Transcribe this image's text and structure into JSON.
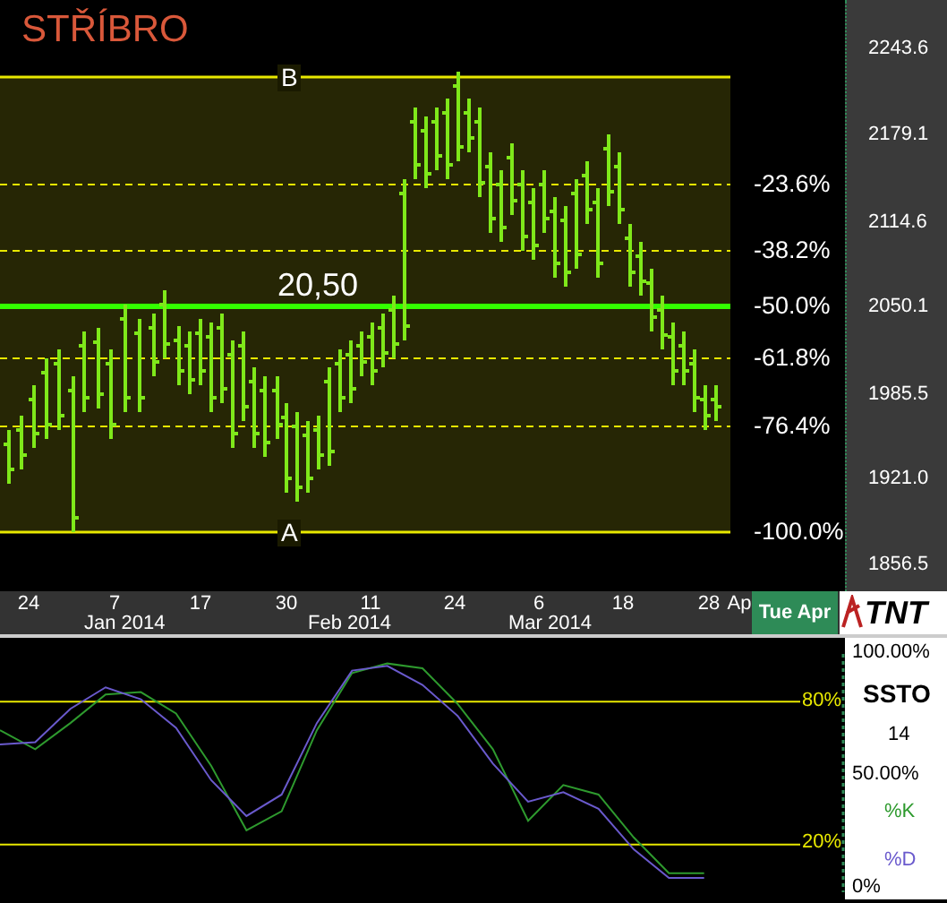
{
  "title": "STŘÍBRO",
  "markers": [
    {
      "label": "B",
      "kind": "top"
    },
    {
      "label": "A",
      "kind": "bottom"
    }
  ],
  "level_value": "20,50",
  "fib_levels": [
    "-23.6%",
    "-38.2%",
    "-50.0%",
    "-61.8%",
    "-76.4%",
    "-100.0%"
  ],
  "price_axis": [
    "2243.6",
    "2179.1",
    "2114.6",
    "2050.1",
    "1985.5",
    "1921.0",
    "1856.5"
  ],
  "time_axis": {
    "days": [
      "24",
      "7",
      "17",
      "30",
      "11",
      "24",
      "6",
      "18",
      "28",
      "Ap"
    ],
    "months": [
      "Jan 2014",
      "Feb 2014",
      "Mar 2014"
    ],
    "cursor_date": "Tue Apr",
    "logo": "TNT"
  },
  "oscillator": {
    "name": "SSTO",
    "period": "14",
    "scale": [
      "100.00%",
      "50.00%",
      "0%"
    ],
    "chart_data": {
      "type": "line",
      "ylim": [
        0,
        100
      ],
      "yticks": [
        {
          "value": 80,
          "label": "80%"
        },
        {
          "value": 20,
          "label": "20%"
        }
      ],
      "series": [
        {
          "name": "%K",
          "color": "#2e9a2e",
          "values": [
            68,
            60,
            71,
            83,
            84,
            75,
            53,
            26,
            34,
            68,
            92,
            96,
            94,
            79,
            60,
            30,
            45,
            41,
            23,
            8,
            8,
            null,
            null,
            null,
            null
          ]
        },
        {
          "name": "%D",
          "color": "#6a5acd",
          "values": [
            62,
            63,
            77,
            86,
            81,
            69,
            47,
            32,
            41,
            71,
            93,
            95,
            87,
            74,
            54,
            38,
            42,
            35,
            18,
            6,
            6,
            null,
            null,
            null,
            null
          ]
        }
      ]
    }
  }
}
